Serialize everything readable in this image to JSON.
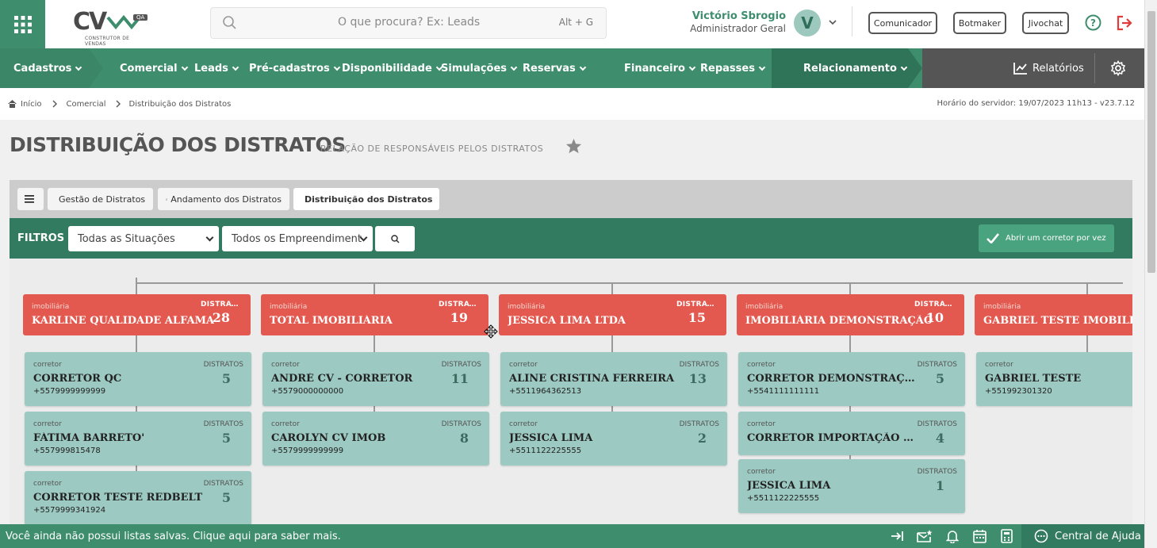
{
  "header": {
    "logo_text": "CV",
    "logo_badge": "QA",
    "logo_sub": "CONSTRUTOR DE VENDAS",
    "search_placeholder": "O que procura? Ex: Leads",
    "search_shortcut": "Alt + G",
    "user_name": "Victório Sbrogio",
    "user_role": "Administrador Geral",
    "avatar_letter": "V",
    "buttons": [
      "Comunicador",
      "Botmaker",
      "Jivochat"
    ]
  },
  "nav": {
    "items": [
      "Cadastros",
      "Comercial",
      "Leads",
      "Pré-cadastros",
      "Disponibilidade",
      "Simulações",
      "Reservas",
      "Financeiro",
      "Repasses",
      "Relacionamento"
    ],
    "reports": "Relatórios"
  },
  "breadcrumb": {
    "items": [
      "Início",
      "Comercial",
      "Distribuição dos Distratos"
    ],
    "server_time": "Horário do servidor: 19/07/2023 11h13 - v23.7.12"
  },
  "page": {
    "title": "DISTRIBUIÇÃO DOS DISTRATOS",
    "subtitle": "RELAÇÃO DE RESPONSÁVEIS PELOS DISTRATOS"
  },
  "tabs": [
    "Gestão de Distratos",
    "Andamento dos Distratos",
    "Distribuição dos Distratos"
  ],
  "filters": {
    "label": "FILTROS",
    "situacao": "Todas as Situações",
    "empreendimento": "Todos os Empreendiment",
    "open_one": "Abrir um corretor por vez"
  },
  "tree": {
    "type_imob": "imobiliária",
    "type_corr": "corretor",
    "distratos_label_short": "DISTRAT...",
    "distratos_label": "DISTRATOS",
    "columns": [
      {
        "name": "KARLINE QUALIDADE ALFAMA",
        "count": "28",
        "brokers": [
          {
            "name": "CORRETOR QC",
            "phone": "+5579999999999",
            "count": "5"
          },
          {
            "name": "FÁTIMA BARRETO'",
            "phone": "+557999815478",
            "count": "5"
          },
          {
            "name": "CORRETOR TESTE REDBELT",
            "phone": "+5579999341924",
            "count": "5"
          }
        ]
      },
      {
        "name": "TOTAL IMOBILIÁRIA",
        "count": "19",
        "brokers": [
          {
            "name": "ANDRÉ CV - CORRETOR",
            "phone": "+5579000000000",
            "count": "11"
          },
          {
            "name": "CAROLYN CV IMOB",
            "phone": "+5579999999999",
            "count": "8"
          }
        ]
      },
      {
        "name": "JESSICA LIMA LTDA",
        "count": "15",
        "brokers": [
          {
            "name": "ALINE CRISTINA FERREIRA",
            "phone": "+5511964362513",
            "count": "13"
          },
          {
            "name": "JESSICA LIMA",
            "phone": "+5511122225555",
            "count": "2"
          }
        ]
      },
      {
        "name": "IMOBILIÁRIA DEMONSTRAÇÃO",
        "count": "10",
        "brokers": [
          {
            "name": "CORRETOR DEMONSTRAÇÃO",
            "phone": "+5541111111111",
            "count": "5"
          },
          {
            "name": "CORRETOR IMPORTAÇÃO RES...",
            "phone": "",
            "count": "4"
          },
          {
            "name": "JESSICA LIMA",
            "phone": "+5511122225555",
            "count": "1"
          }
        ]
      },
      {
        "name": "GABRIEL TESTE IMOBILIÁRIA",
        "count": "",
        "brokers": [
          {
            "name": "GABRIEL TESTE",
            "phone": "+551992301320",
            "count": ""
          }
        ]
      }
    ]
  },
  "footer": {
    "message": "Você ainda não possui listas salvas. Clique aqui para saber mais.",
    "help_center": "Central de Ajuda"
  },
  "colors": {
    "green": "#3e8e6e",
    "dark_green": "#327a60",
    "red": "#e3594f",
    "teal_card": "#9cc9c1"
  }
}
